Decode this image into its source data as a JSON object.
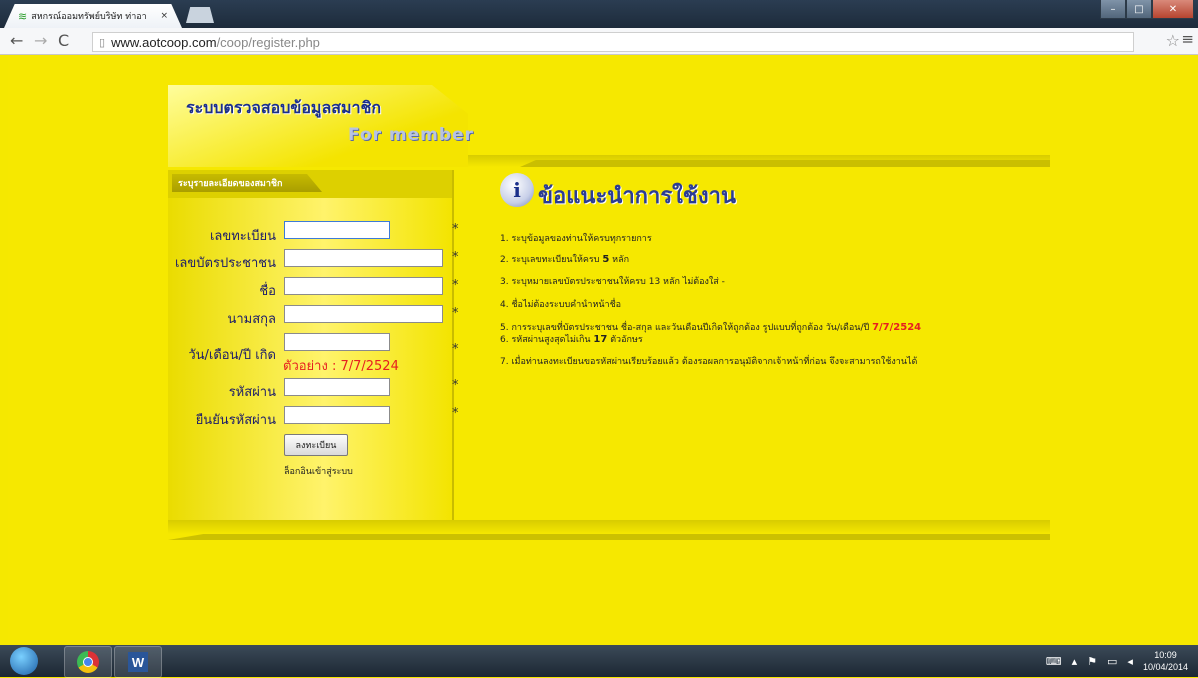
{
  "browser": {
    "tab_title": "สหกรณ์ออมทรัพย์บริษัท ท่าอา",
    "tab_close": "×",
    "url_host": "www.aotcoop.com",
    "url_path": "/coop/register.php"
  },
  "banner": {
    "title_th": "ระบบตรวจสอบข้อมูลสมาชิก",
    "title_en": "For member"
  },
  "form": {
    "section_tab": "ระบุรายละเอียดของสมาชิก",
    "fields": [
      {
        "label": "เลขทะเบียน",
        "value": ""
      },
      {
        "label": "เลขบัตรประชาชน",
        "value": ""
      },
      {
        "label": "ชื่อ",
        "value": ""
      },
      {
        "label": "นามสกุล",
        "value": ""
      },
      {
        "label": "วัน/เดือน/ปี เกิด",
        "value": ""
      },
      {
        "label": "รหัสผ่าน",
        "value": ""
      },
      {
        "label": "ยืนยันรหัสผ่าน",
        "value": ""
      }
    ],
    "required_mark": "*",
    "dob_example": "ตัวอย่าง : 7/7/2524",
    "register_button": "ลงทะเบียน",
    "login_link": "ล็อกอินเข้าสู่ระบบ"
  },
  "instructions": {
    "title": "ข้อแนะนำการใช้งาน",
    "items": [
      {
        "text": "1. ระบุข้อมูลของท่านให้ครบทุกรายการ"
      },
      {
        "text": "2. ระบุเลขทะเบียนให้ครบ ",
        "bold": "5",
        "after": " หลัก"
      },
      {
        "text": "3. ระบุหมายเลขบัตรประชาชนให้ครบ 13 หลัก ไม่ต้องใส่ -"
      },
      {
        "text": "4. ชื่อไม่ต้องระบบคำนำหน้าชื่อ"
      },
      {
        "text": "5. การระบุเลขที่บัตรประชาชน ชื่อ-สกุล และวันเดือนปีเกิดให้ถูกต้อง รูปแบบที่ถูกต้อง วัน/เดือน/ปี ",
        "red": "7/7/2524"
      },
      {
        "text": "6. รหัสผ่านสูงสุดไม่เกิน ",
        "bold": "17",
        "after": " ตัวอักษร"
      },
      {
        "text": "7. เมื่อท่านลงทะเบียนขอรหัสผ่านเรียบร้อยแล้ว ต้องรอผลการอนุมัติจากเจ้าหน้าที่ก่อน จึงจะสามารถใช้งานได้"
      }
    ]
  },
  "taskbar": {
    "word_letter": "W",
    "time": "10:09",
    "date": "10/04/2014"
  }
}
